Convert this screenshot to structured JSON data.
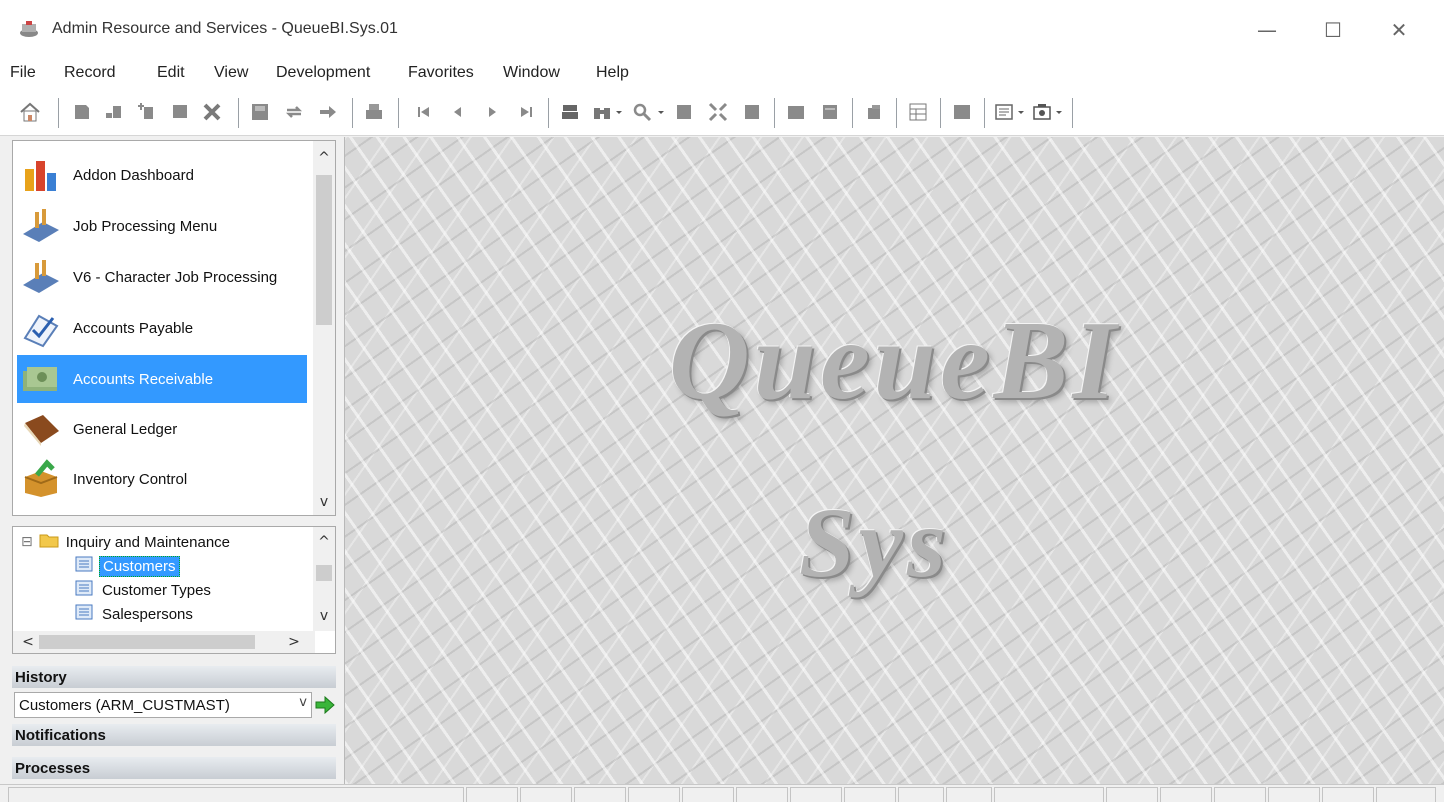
{
  "window": {
    "title": "Admin Resource and Services - QueueBI.Sys.01",
    "controls": {
      "minimize": "—",
      "maximize": "☐",
      "close": "✕"
    }
  },
  "menu": [
    "File",
    "Record",
    "Edit",
    "View",
    "Development",
    "Favorites",
    "Window",
    "Help"
  ],
  "toolbar": {
    "icons": [
      "home-icon",
      "new-record-icon",
      "insert-record-icon",
      "insert-before-icon",
      "copy-record-icon",
      "delete-icon",
      "save-icon",
      "refresh-icon",
      "forward-icon",
      "print-icon",
      "first-record-icon",
      "previous-record-icon",
      "next-record-icon",
      "last-record-icon",
      "lookup-icon",
      "find-icon",
      "zoom-icon",
      "grid-icon",
      "expand-icon",
      "form-icon",
      "list-icon",
      "report-icon",
      "attach-icon",
      "calendar-icon",
      "window-icon",
      "layout-icon",
      "screenshot-icon"
    ]
  },
  "nav_list": {
    "items": [
      {
        "label": "Addon Dashboard",
        "icon": "bar-chart-icon",
        "selected": false
      },
      {
        "label": "Job Processing Menu",
        "icon": "job-processing-icon",
        "selected": false
      },
      {
        "label": "V6 - Character Job Processing",
        "icon": "job-processing-icon",
        "selected": false
      },
      {
        "label": "Accounts Payable",
        "icon": "checklist-icon",
        "selected": false
      },
      {
        "label": "Accounts Receivable",
        "icon": "money-icon",
        "selected": true
      },
      {
        "label": "General Ledger",
        "icon": "book-icon",
        "selected": false
      },
      {
        "label": "Inventory Control",
        "icon": "box-icon",
        "selected": false
      }
    ],
    "scroll": {
      "up": "^",
      "down": "v"
    }
  },
  "tree": {
    "folder": {
      "toggle": "⊟",
      "label": "Inquiry and Maintenance"
    },
    "items": [
      {
        "label": "Customers",
        "selected": true
      },
      {
        "label": "Customer Types",
        "selected": false
      },
      {
        "label": "Salespersons",
        "selected": false
      }
    ],
    "scroll": {
      "up": "^",
      "down": "v",
      "left": "<",
      "right": ">"
    }
  },
  "history": {
    "header": "History",
    "selected": "Customers (ARM_CUSTMAST)",
    "dropdown_glyph": "v"
  },
  "notifications": {
    "header": "Notifications"
  },
  "processes": {
    "header": "Processes"
  },
  "logo": {
    "line1": "QueueBI",
    "line2": "Sys"
  },
  "colors": {
    "selection": "#3399ff",
    "panel_bg": "#f0f0f0",
    "plate": "#d9d9d9"
  }
}
